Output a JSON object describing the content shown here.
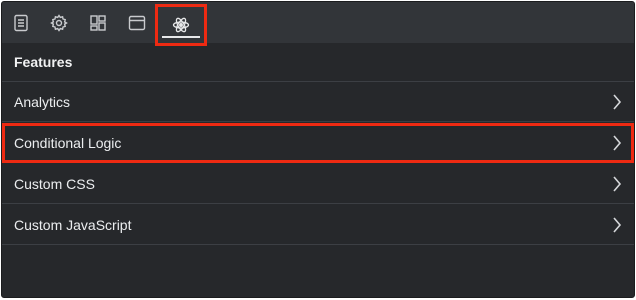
{
  "tabs": [
    {
      "icon": "document-icon"
    },
    {
      "icon": "gear-icon"
    },
    {
      "icon": "layout-grid-icon"
    },
    {
      "icon": "window-icon"
    },
    {
      "icon": "atom-icon",
      "active": true
    }
  ],
  "section": {
    "title": "Features"
  },
  "rows": [
    {
      "label": "Analytics"
    },
    {
      "label": "Conditional Logic",
      "highlighted": true
    },
    {
      "label": "Custom CSS"
    },
    {
      "label": "Custom JavaScript"
    }
  ],
  "colors": {
    "background": "#26282b",
    "tabbar": "#323539",
    "highlight": "#ee2a12",
    "text": "#eceef0",
    "divider": "#3c3f44"
  }
}
